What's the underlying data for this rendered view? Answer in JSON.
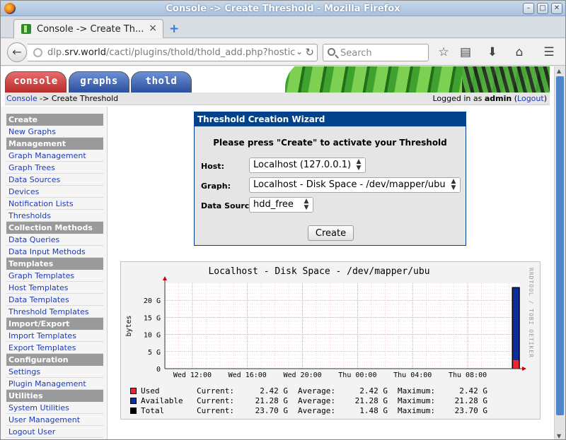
{
  "window": {
    "title": "Console -> Create Threshold - Mozilla Firefox"
  },
  "tab": {
    "title": "Console -> Create Th...",
    "close": "×",
    "new": "+"
  },
  "nav": {
    "url_prefix": "dlp.",
    "url_host": "srv.world",
    "url_path": "/cacti/plugins/thold/thold_add.php?hostic",
    "search_placeholder": "Search"
  },
  "cacti_tabs": {
    "console": "console",
    "graphs": "graphs",
    "thold": "thold"
  },
  "breadcrumb": {
    "link": "Console",
    "rest": " -> Create Threshold"
  },
  "login": {
    "prefix": "Logged in as ",
    "user": "admin",
    "open": " (",
    "logout": "Logout",
    "close": ")"
  },
  "sidebar": [
    {
      "header": "Create",
      "items": [
        "New Graphs"
      ]
    },
    {
      "header": "Management",
      "items": [
        "Graph Management",
        "Graph Trees",
        "Data Sources",
        "Devices",
        "Notification Lists",
        "Thresholds"
      ]
    },
    {
      "header": "Collection Methods",
      "items": [
        "Data Queries",
        "Data Input Methods"
      ]
    },
    {
      "header": "Templates",
      "items": [
        "Graph Templates",
        "Host Templates",
        "Data Templates",
        "Threshold Templates"
      ]
    },
    {
      "header": "Import/Export",
      "items": [
        "Import Templates",
        "Export Templates"
      ]
    },
    {
      "header": "Configuration",
      "items": [
        "Settings",
        "Plugin Management"
      ]
    },
    {
      "header": "Utilities",
      "items": [
        "System Utilities",
        "User Management",
        "Logout User"
      ]
    }
  ],
  "wizard": {
    "title": "Threshold Creation Wizard",
    "message": "Please press \"Create\" to activate your Threshold",
    "host_label": "Host:",
    "host_value": "Localhost (127.0.0.1)",
    "graph_label": "Graph:",
    "graph_value": "Localhost - Disk Space - /dev/mapper/ubu",
    "ds_label": "Data Source:",
    "ds_value": "hdd_free",
    "create": "Create"
  },
  "graph": {
    "title": "Localhost - Disk Space - /dev/mapper/ubu",
    "side_text": "RRDTOOL / TOBI OETIKER",
    "legend": [
      {
        "name": "Used",
        "color": "#ee2233",
        "current": "2.42 G",
        "average": "2.42 G",
        "maximum": "2.42 G"
      },
      {
        "name": "Available",
        "color": "#0c2e9c",
        "current": "21.28 G",
        "average": "21.28 G",
        "maximum": "21.28 G"
      },
      {
        "name": "Total",
        "color": "#000000",
        "current": "23.70 G",
        "average": "1.48 G",
        "maximum": "23.70 G"
      }
    ],
    "labels": {
      "current": "Current:",
      "average": "Average:",
      "maximum": "Maximum:"
    }
  },
  "chart_data": {
    "type": "area",
    "title": "Localhost - Disk Space - /dev/mapper/ubu",
    "ylabel": "bytes",
    "ylim": [
      0,
      25
    ],
    "yticks": [
      "0",
      "5 G",
      "10 G",
      "15 G",
      "20 G"
    ],
    "ytick_values": [
      0,
      5,
      10,
      15,
      20
    ],
    "xticks": [
      "Wed 12:00",
      "Wed 16:00",
      "Wed 20:00",
      "Thu 00:00",
      "Thu 04:00",
      "Thu 08:00"
    ],
    "xlim": [
      "Wed 10:00",
      "Thu 11:45"
    ],
    "x": [
      "Thu 11:15",
      "Thu 11:45"
    ],
    "series": [
      {
        "name": "Used",
        "color": "#ee2233",
        "values": [
          2.42,
          2.42
        ]
      },
      {
        "name": "Available",
        "color": "#0c2e9c",
        "values": [
          21.28,
          21.28
        ]
      },
      {
        "name": "Total",
        "color": "#000000",
        "values": [
          23.7,
          23.7
        ]
      }
    ],
    "grid": true
  }
}
